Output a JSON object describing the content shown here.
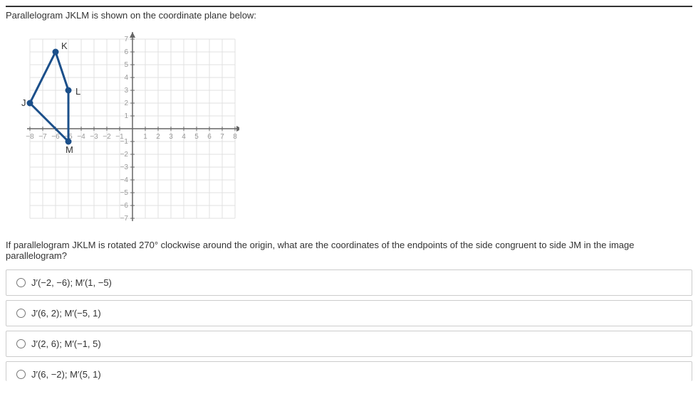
{
  "prompt": "Parallelogram JKLM is shown on the coordinate plane below:",
  "question": "If parallelogram JKLM is rotated 270° clockwise around the origin, what are the coordinates of the endpoints of the side congruent to side JM in the image parallelogram?",
  "options": [
    "J′(−2, −6); M′(1, −5)",
    "J′(6, 2); M′(−5, 1)",
    "J′(2, 6); M′(−1, 5)",
    "J′(6, −2); M′(5, 1)"
  ],
  "chart_data": {
    "type": "scatter",
    "title": "",
    "xlabel": "",
    "ylabel": "",
    "xlim": [
      -8,
      8
    ],
    "ylim": [
      -7,
      7
    ],
    "x_ticks": [
      -8,
      -7,
      -6,
      -5,
      -4,
      -3,
      -2,
      -1,
      1,
      2,
      3,
      4,
      5,
      6,
      7,
      8
    ],
    "y_ticks": [
      -7,
      -6,
      -5,
      -4,
      -3,
      -2,
      -1,
      1,
      2,
      3,
      4,
      5,
      6,
      7
    ],
    "points": [
      {
        "name": "J",
        "x": -8,
        "y": 2
      },
      {
        "name": "K",
        "x": -6,
        "y": 6
      },
      {
        "name": "L",
        "x": -5,
        "y": 3
      },
      {
        "name": "M",
        "x": -5,
        "y": -1
      }
    ],
    "shape": "parallelogram",
    "edges": [
      [
        "J",
        "K"
      ],
      [
        "K",
        "L"
      ],
      [
        "L",
        "M"
      ],
      [
        "M",
        "J"
      ]
    ]
  },
  "colors": {
    "grid": "#e0e0e0",
    "grid_bold": "#bdbdbd",
    "axis": "#666",
    "shape": "#1b4f8a",
    "point": "#1b4f8a",
    "tick_label": "#999"
  }
}
